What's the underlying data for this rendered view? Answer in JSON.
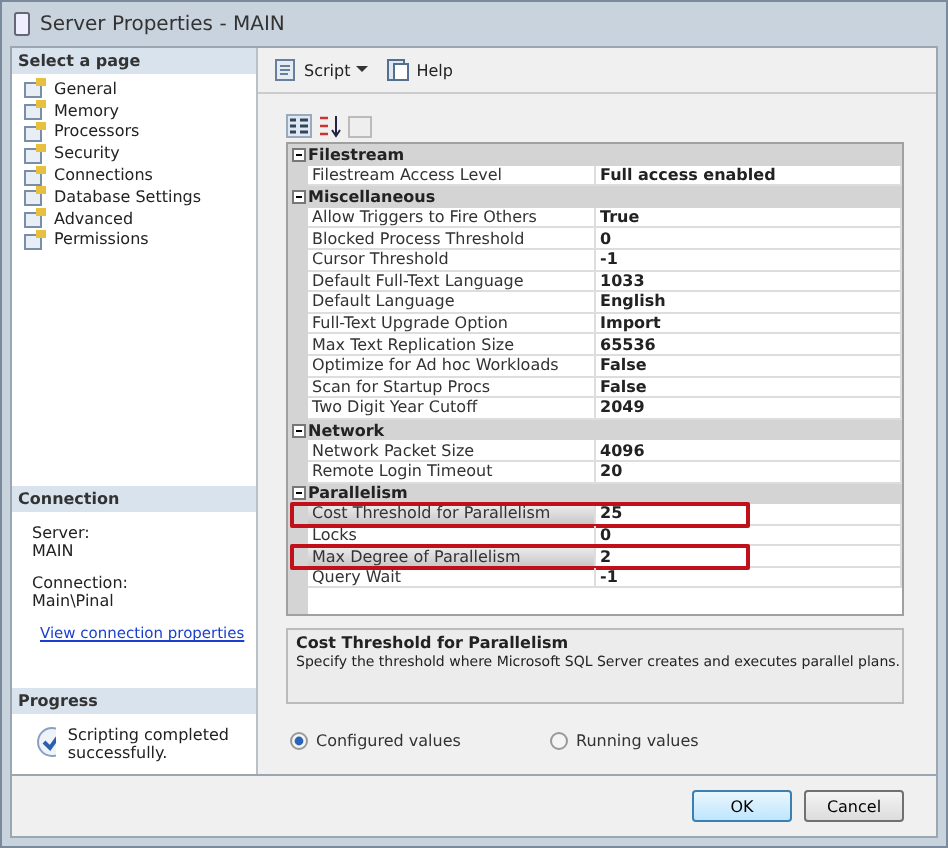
{
  "window": {
    "title": "Server Properties - MAIN"
  },
  "sidebar": {
    "header": "Select a page",
    "items": [
      {
        "label": "General"
      },
      {
        "label": "Memory"
      },
      {
        "label": "Processors"
      },
      {
        "label": "Security"
      },
      {
        "label": "Connections"
      },
      {
        "label": "Database Settings"
      },
      {
        "label": "Advanced"
      },
      {
        "label": "Permissions"
      }
    ]
  },
  "connection": {
    "header": "Connection",
    "fields": [
      {
        "label": "Server:",
        "value": "MAIN"
      },
      {
        "label": "Connection:",
        "value": "Main\\Pinal"
      }
    ],
    "link": "View connection properties"
  },
  "progress": {
    "header": "Progress",
    "status": "Scripting completed successfully."
  },
  "toolbar": {
    "script": "Script",
    "help": "Help"
  },
  "grid": {
    "categories": [
      {
        "name": "Filestream",
        "expanded": true,
        "rows": [
          {
            "name": "Filestream Access Level",
            "value": "Full access enabled",
            "highlighted": false
          }
        ]
      },
      {
        "name": "Miscellaneous",
        "expanded": true,
        "rows": [
          {
            "name": "Allow Triggers to Fire Others",
            "value": "True",
            "highlighted": false
          },
          {
            "name": "Blocked Process Threshold",
            "value": "0",
            "highlighted": false
          },
          {
            "name": "Cursor Threshold",
            "value": "-1",
            "highlighted": false
          },
          {
            "name": "Default Full-Text Language",
            "value": "1033",
            "highlighted": false
          },
          {
            "name": "Default Language",
            "value": "English",
            "highlighted": false
          },
          {
            "name": "Full-Text Upgrade Option",
            "value": "Import",
            "highlighted": false
          },
          {
            "name": "Max Text Replication Size",
            "value": "65536",
            "highlighted": false
          },
          {
            "name": "Optimize for Ad hoc Workloads",
            "value": "False",
            "highlighted": false
          },
          {
            "name": "Scan for Startup Procs",
            "value": "False",
            "highlighted": false
          },
          {
            "name": "Two Digit Year Cutoff",
            "value": "2049",
            "highlighted": false
          }
        ]
      },
      {
        "name": "Network",
        "expanded": true,
        "rows": [
          {
            "name": "Network Packet Size",
            "value": "4096",
            "highlighted": false
          },
          {
            "name": "Remote Login Timeout",
            "value": "20",
            "highlighted": false
          }
        ]
      },
      {
        "name": "Parallelism",
        "expanded": true,
        "rows": [
          {
            "name": "Cost Threshold for Parallelism",
            "value": "25",
            "highlighted": true
          },
          {
            "name": "Locks",
            "value": "0",
            "highlighted": false
          },
          {
            "name": "Max Degree of Parallelism",
            "value": "2",
            "highlighted": true
          },
          {
            "name": "Query Wait",
            "value": "-1",
            "highlighted": false
          }
        ]
      }
    ]
  },
  "description": {
    "title": "Cost Threshold for Parallelism",
    "text": "Specify the threshold where Microsoft SQL Server creates and executes parallel plans."
  },
  "options": [
    {
      "label": "Configured values",
      "selected": true
    },
    {
      "label": "Running values",
      "selected": false
    }
  ],
  "buttons": [
    {
      "label": "OK",
      "kind": "default"
    },
    {
      "label": "Cancel",
      "kind": "normal"
    }
  ]
}
